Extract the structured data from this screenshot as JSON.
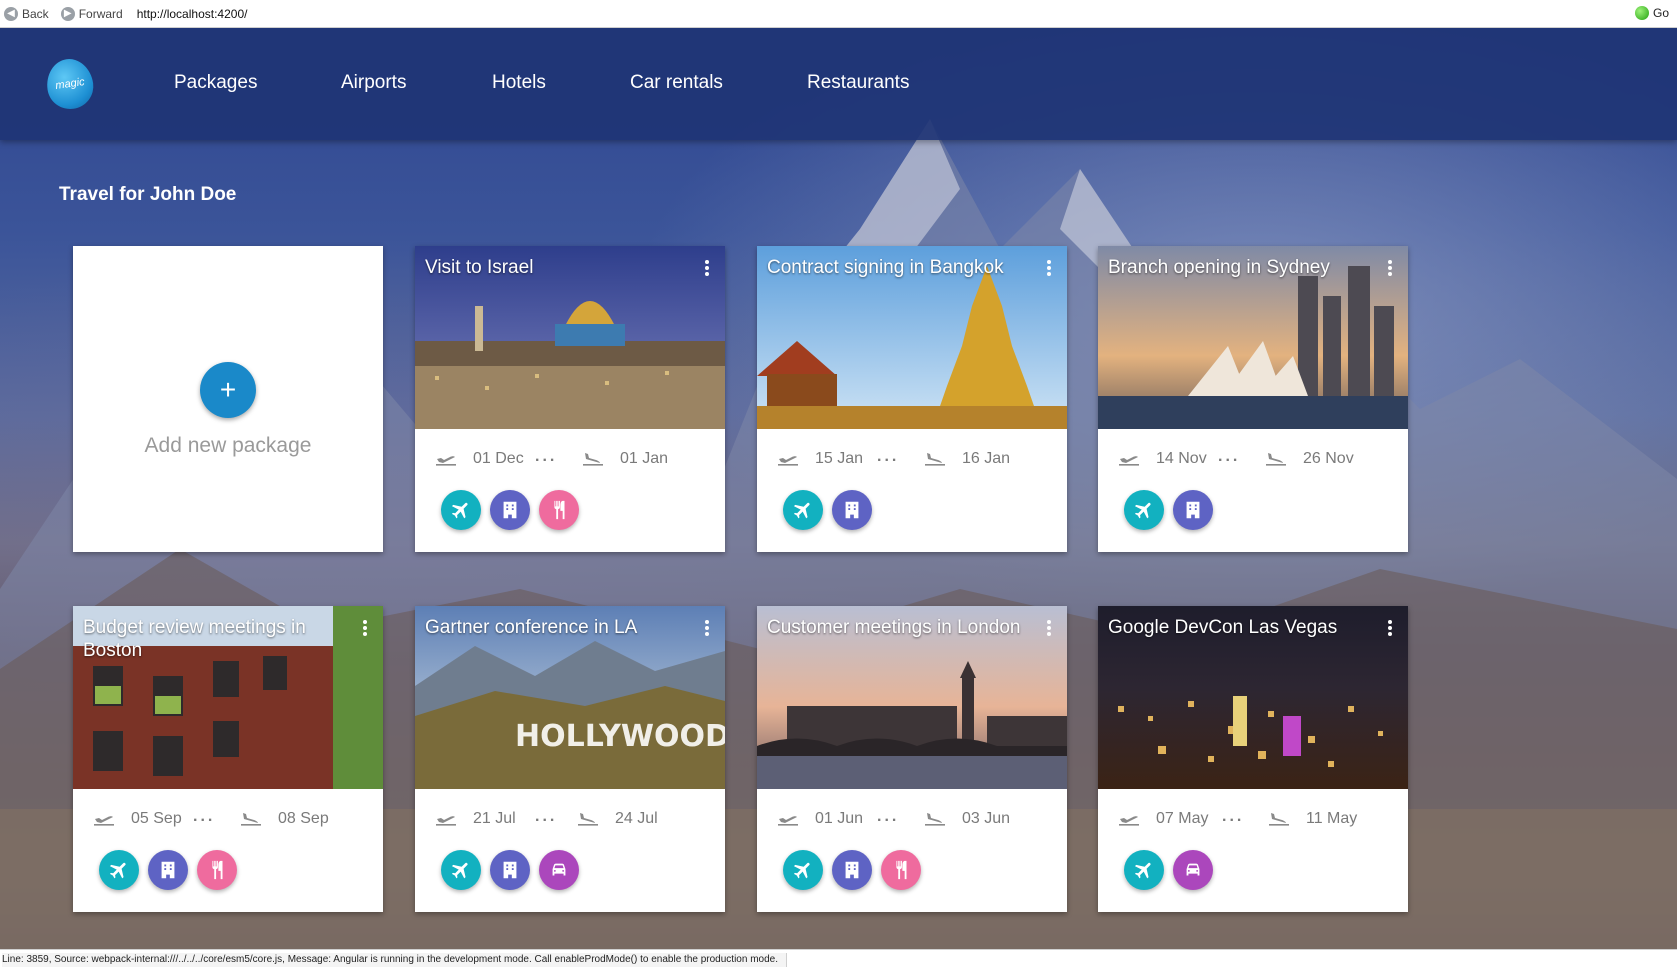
{
  "browser": {
    "back_label": "Back",
    "forward_label": "Forward",
    "url": "http://localhost:4200/",
    "go_label": "Go"
  },
  "navbar": {
    "logo_text": "magic",
    "items": [
      "Packages",
      "Airports",
      "Hotels",
      "Car rentals",
      "Restaurants"
    ]
  },
  "page_title": "Travel for John Doe",
  "add_card": {
    "button_symbol": "+",
    "label": "Add new package"
  },
  "packages": [
    {
      "title": "Visit to Israel",
      "depart": "01 Dec",
      "return": "01 Jan",
      "services": [
        "flight",
        "hotel",
        "restaurant"
      ]
    },
    {
      "title": "Contract signing in Bangkok",
      "depart": "15 Jan",
      "return": "16 Jan",
      "services": [
        "flight",
        "hotel"
      ]
    },
    {
      "title": "Branch opening in Sydney",
      "depart": "14 Nov",
      "return": "26 Nov",
      "services": [
        "flight",
        "hotel"
      ]
    },
    {
      "title": "Budget review meetings in Boston",
      "depart": "05 Sep",
      "return": "08 Sep",
      "services": [
        "flight",
        "hotel",
        "restaurant"
      ]
    },
    {
      "title": "Gartner conference in LA",
      "depart": "21 Jul",
      "return": "24 Jul",
      "services": [
        "flight",
        "hotel",
        "car"
      ]
    },
    {
      "title": "Customer meetings in London",
      "depart": "01 Jun",
      "return": "03 Jun",
      "services": [
        "flight",
        "hotel",
        "restaurant"
      ]
    },
    {
      "title": "Google DevCon Las Vegas",
      "depart": "07 May",
      "return": "11 May",
      "services": [
        "flight",
        "car"
      ]
    }
  ],
  "image_text": {
    "hollywood_sign": "HOLLYWOOD"
  },
  "statusbar": {
    "message": "Line: 3859, Source: webpack-internal:///../../../core/esm5/core.js, Message: Angular is running in the development mode. Call enableProdMode() to enable the production mode."
  },
  "colors": {
    "navbar": "#1f3575",
    "flight": "#12b1c0",
    "hotel": "#5e63c4",
    "restaurant": "#ef6b9e",
    "car": "#ab47bc",
    "add_button": "#1a89c9"
  }
}
